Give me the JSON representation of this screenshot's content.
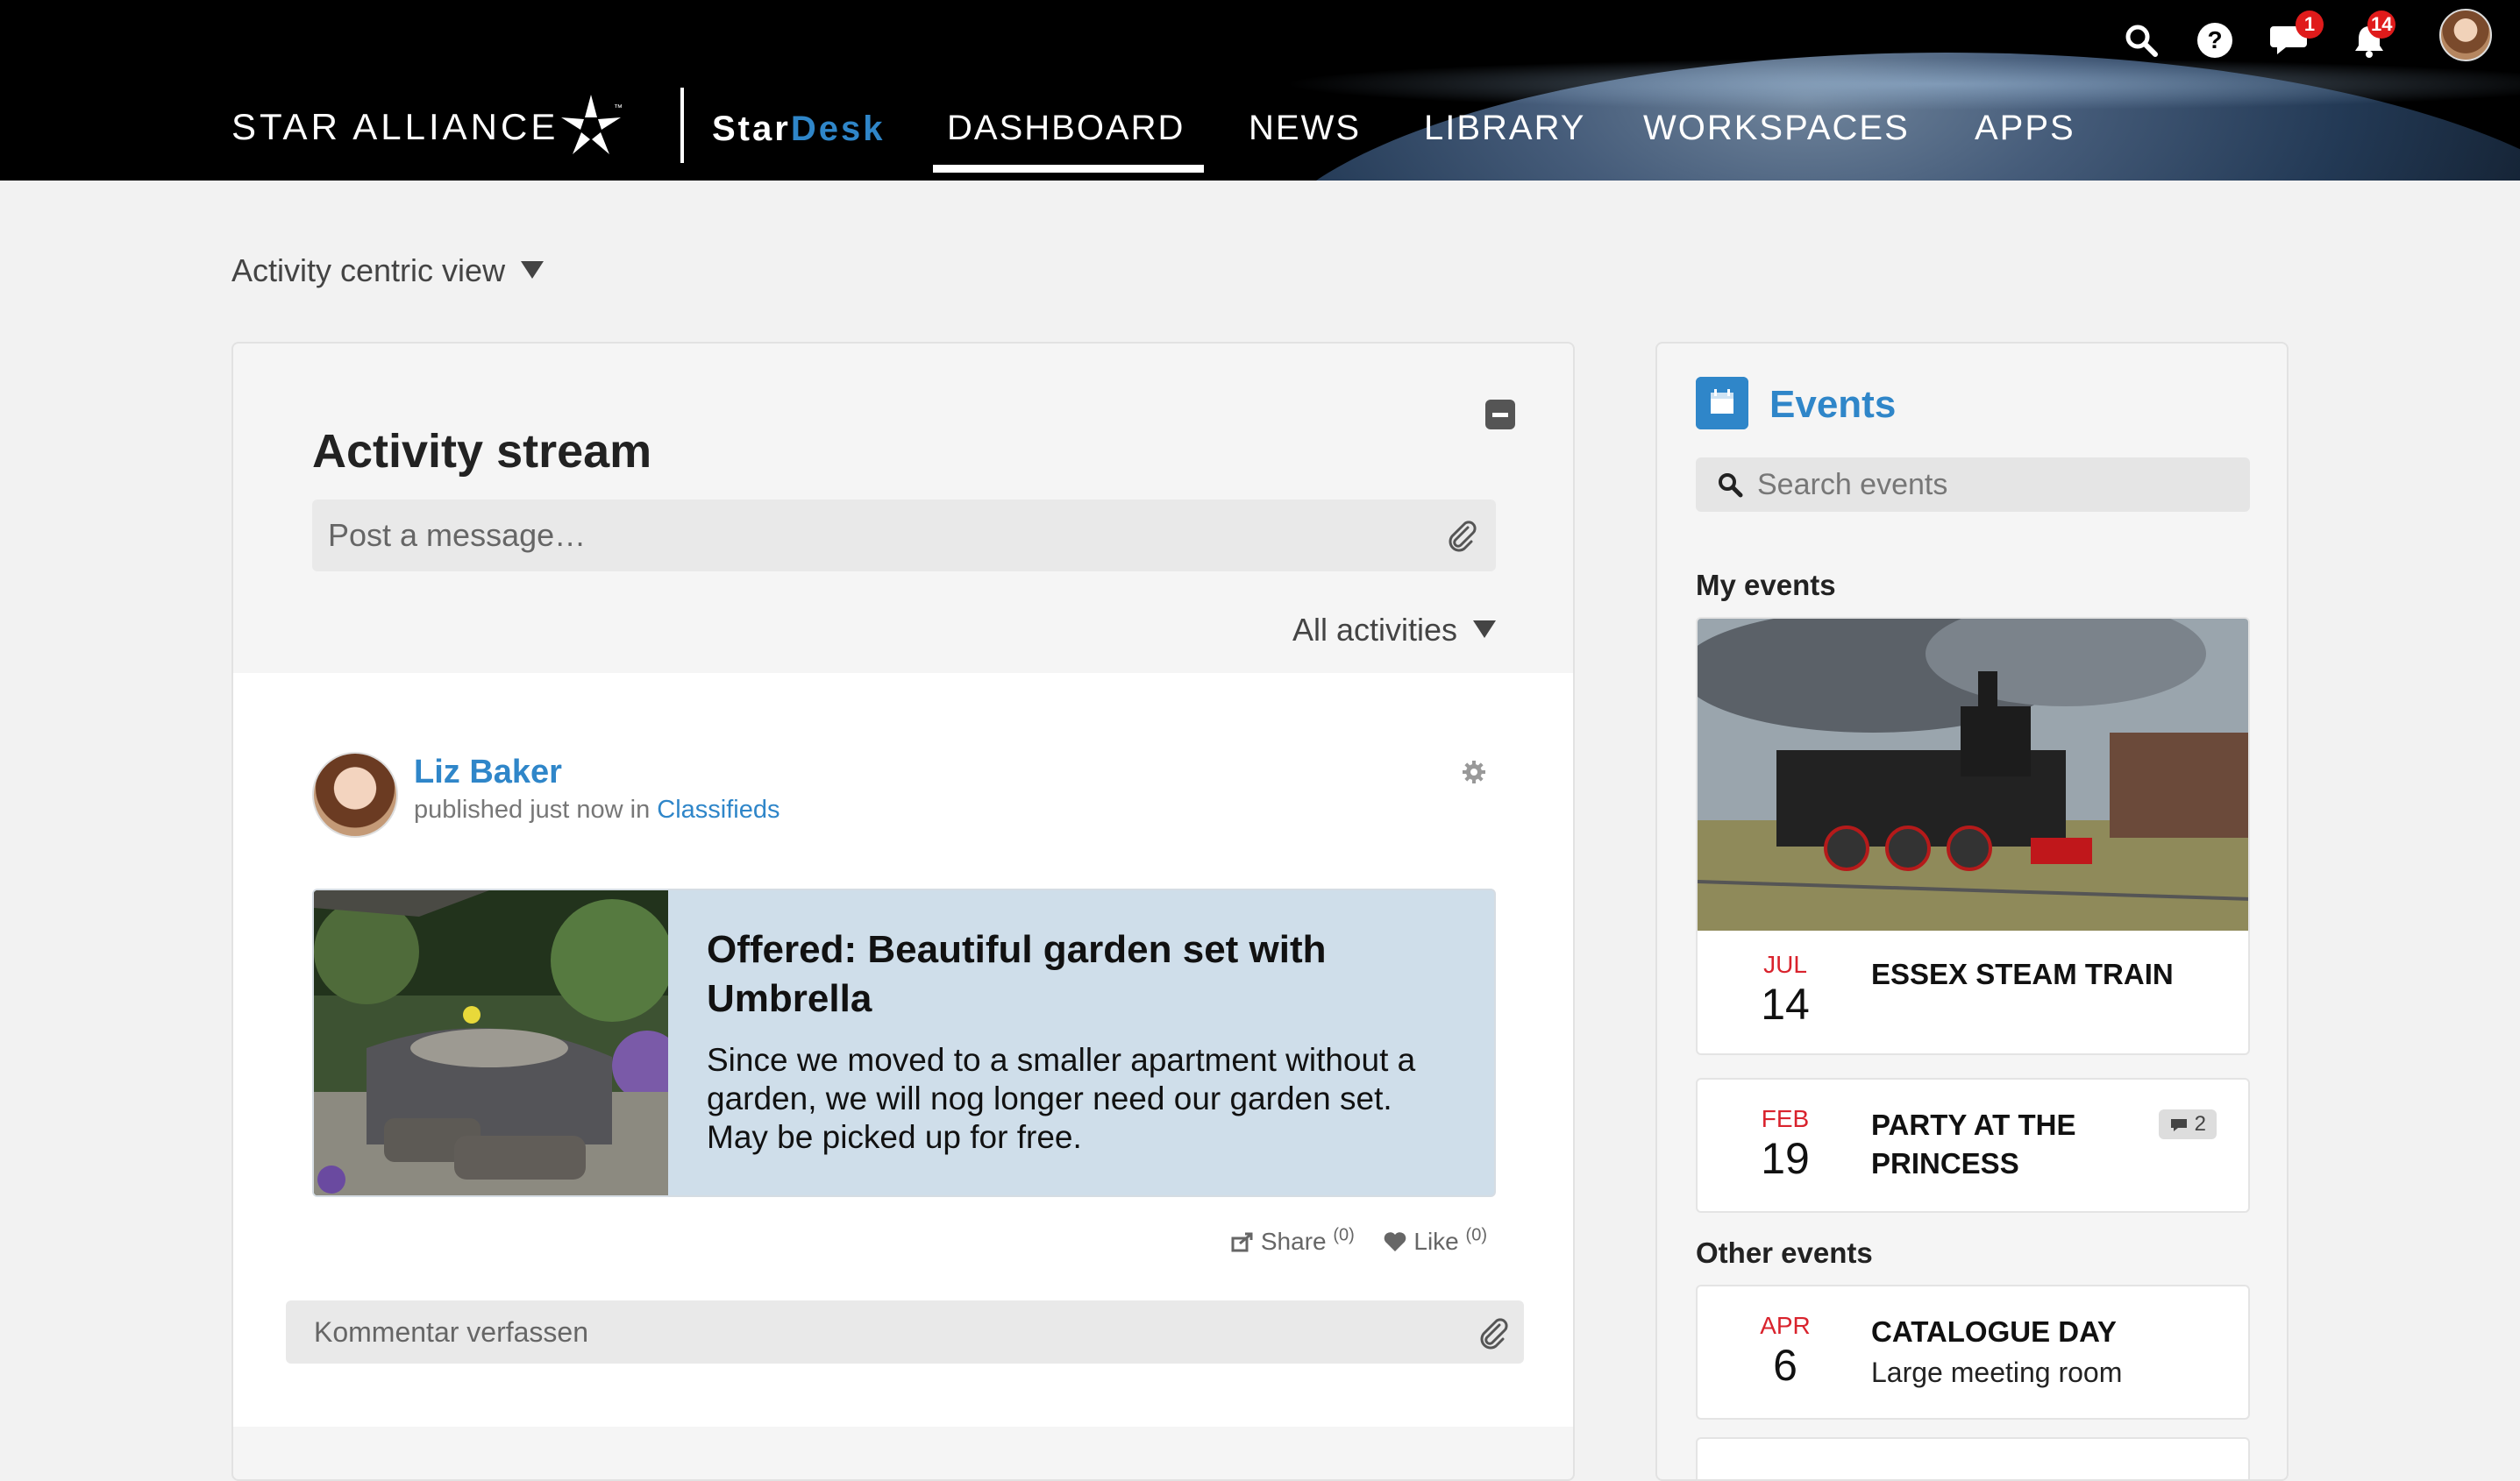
{
  "brand": {
    "name": "STAR ALLIANCE",
    "tm": "™",
    "product_star": "Star",
    "product_desk": "Desk"
  },
  "nav": [
    {
      "label": "DASHBOARD",
      "active": true
    },
    {
      "label": "NEWS"
    },
    {
      "label": "LIBRARY"
    },
    {
      "label": "WORKSPACES"
    },
    {
      "label": "APPS"
    }
  ],
  "top_icons": {
    "chat_badge": "1",
    "notifications_badge": "14"
  },
  "view_selector": "Activity centric view",
  "activity": {
    "title": "Activity stream",
    "post_placeholder": "Post a message…",
    "filter": "All activities",
    "post": {
      "author": "Liz Baker",
      "meta_prefix": "published just now in",
      "meta_link": "Classifieds",
      "ad_title": "Offered: Beautiful garden set with Umbrella",
      "ad_desc": "Since we moved to a smaller apartment without a garden, we will nog longer need our garden set. May be picked up for free.",
      "share_label": "Share",
      "share_count": "(0)",
      "like_label": "Like",
      "like_count": "(0)"
    },
    "comment_placeholder": "Kommentar verfassen"
  },
  "events": {
    "title": "Events",
    "search_placeholder": "Search events",
    "my_events_label": "My events",
    "other_events_label": "Other events",
    "my_events": [
      {
        "month": "JUL",
        "day": "14",
        "name": "ESSEX STEAM TRAIN"
      },
      {
        "month": "FEB",
        "day": "19",
        "name_line1": "PARTY AT THE",
        "name_line2": "PRINCESS",
        "comments": "2"
      }
    ],
    "other_events": [
      {
        "month": "APR",
        "day": "6",
        "name": "CATALOGUE DAY",
        "location": "Large meeting room"
      }
    ]
  },
  "colors": {
    "accent": "#2f86c9",
    "date_month": "#d9232d",
    "badge": "#e01b1b",
    "ad_bg": "#cfdeea"
  }
}
